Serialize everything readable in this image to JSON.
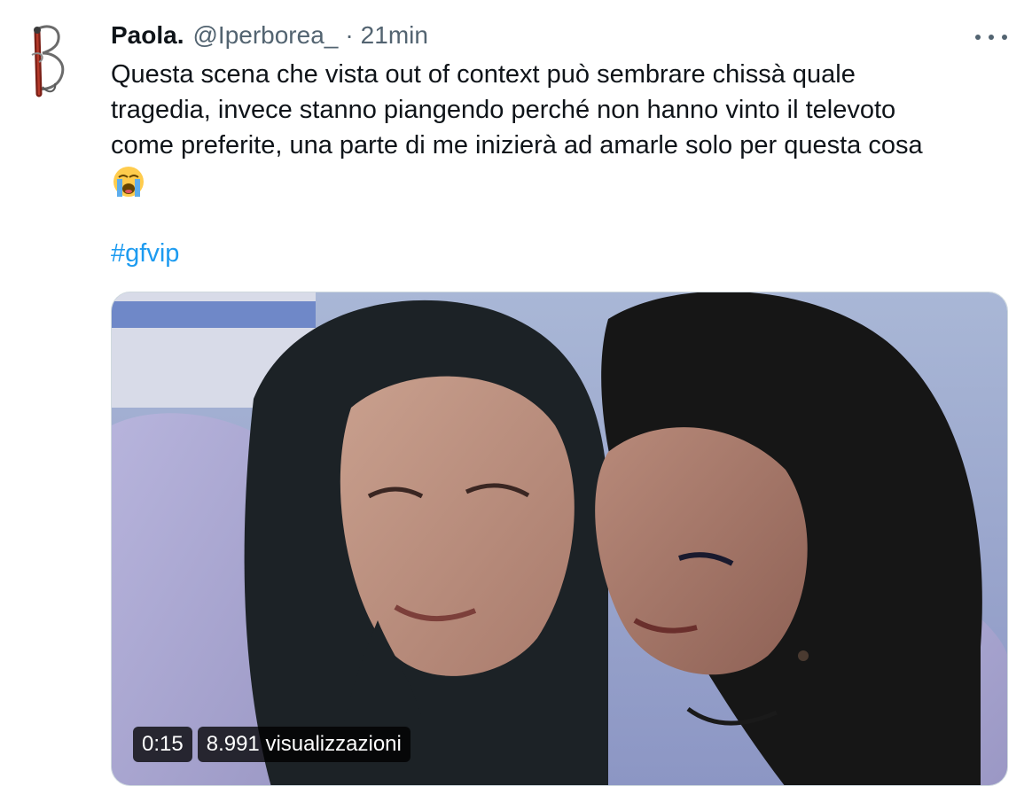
{
  "tweet": {
    "author_name": "Paola.",
    "handle": "@Iperborea_",
    "separator": "·",
    "timestamp": "21min",
    "text_lines": [
      "Questa scena che vista out of context può sembrare chissà quale",
      "tragedia, invece stanno piangendo perché non hanno vinto il televoto",
      "come preferite, una parte di me inizierà ad amarle solo per questa cosa"
    ],
    "emoji": "loudly-crying-face",
    "hashtag": "#gfvip",
    "more_icon": "more-horizontal-icon"
  },
  "video": {
    "duration": "0:15",
    "views": "8.991 visualizzazioni"
  },
  "colors": {
    "link": "#1d9bf0",
    "secondary_text": "#536471",
    "primary_text": "#0f1419"
  }
}
